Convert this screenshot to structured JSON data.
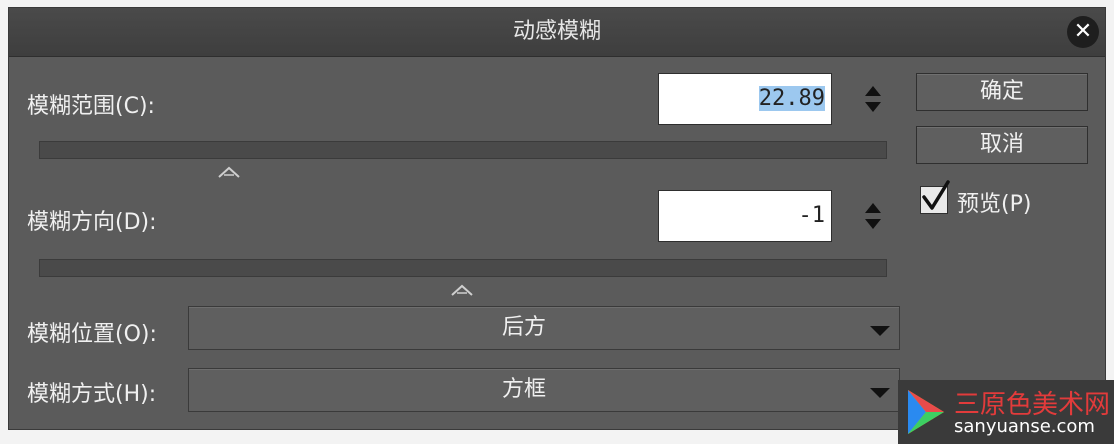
{
  "window": {
    "title": "动感模糊",
    "close_icon": "close-icon"
  },
  "blur_range": {
    "label": "模糊范围(C):",
    "value": "22.89",
    "slider_value": 22.89
  },
  "blur_direction": {
    "label": "模糊方向(D):",
    "value": "-1",
    "slider_value": -1
  },
  "blur_position": {
    "label": "模糊位置(O):",
    "selected": "后方"
  },
  "blur_mode": {
    "label": "模糊方式(H):",
    "selected": "方框"
  },
  "buttons": {
    "ok": "确定",
    "cancel": "取消"
  },
  "preview": {
    "label": "预览(P)",
    "checked": true
  },
  "watermark": {
    "line1": "三原色美术网",
    "line2": "sanyuanse.com",
    "colors": {
      "accent": "#e23b3b"
    }
  }
}
